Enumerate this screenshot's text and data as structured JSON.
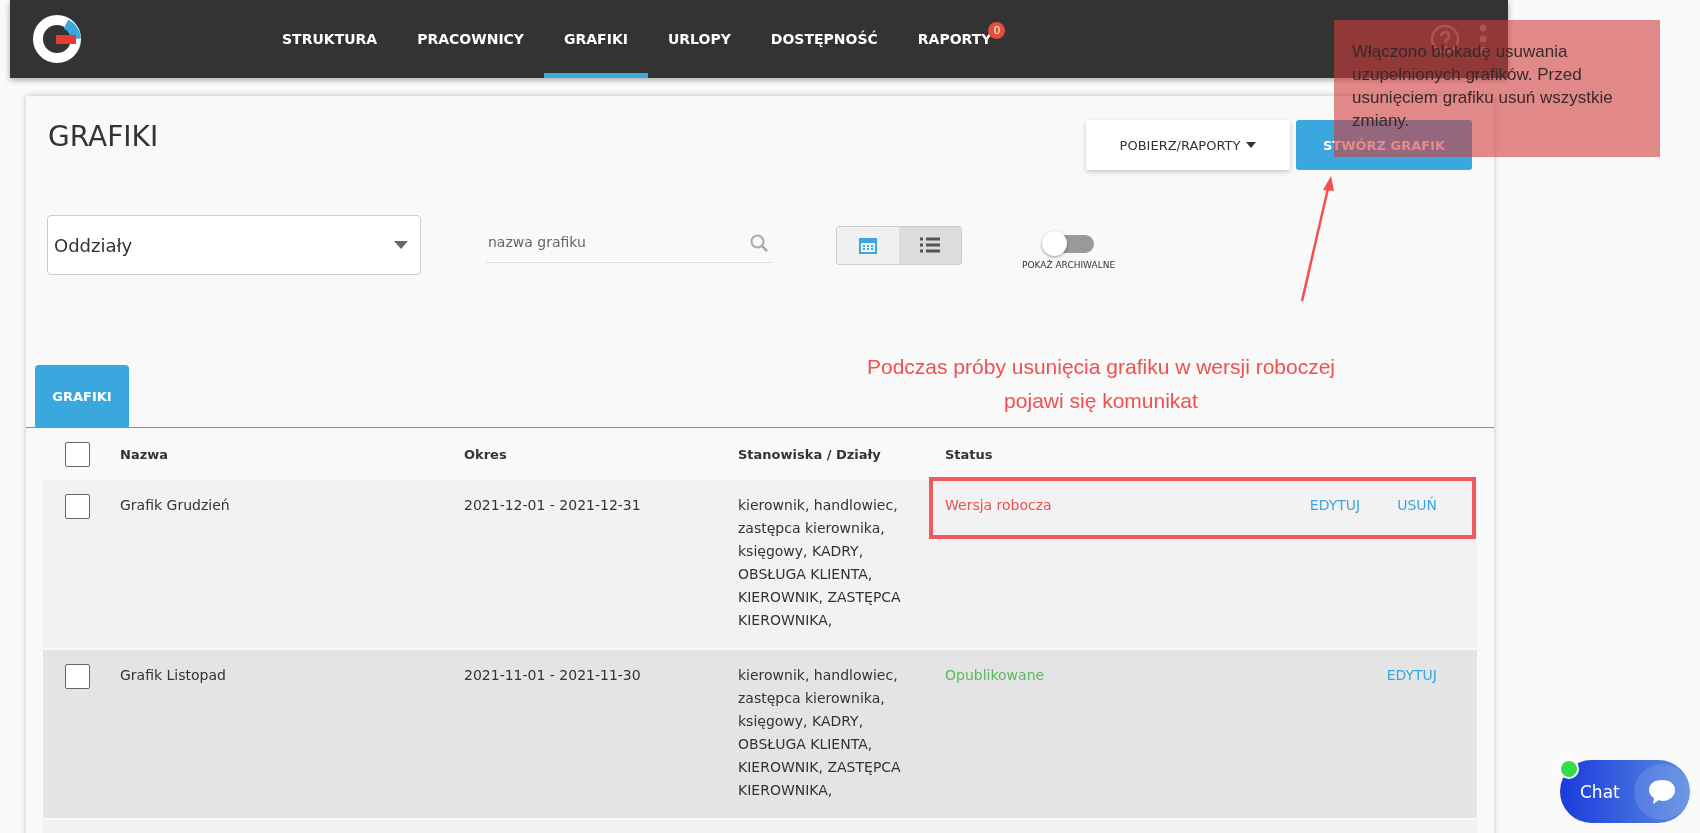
{
  "nav": {
    "items": [
      {
        "label": "STRUKTURA",
        "selected": false
      },
      {
        "label": "PRACOWNICY",
        "selected": false
      },
      {
        "label": "GRAFIKI",
        "selected": true
      },
      {
        "label": "URLOPY",
        "selected": false
      },
      {
        "label": "DOSTĘPNOŚĆ",
        "selected": false
      },
      {
        "label": "RAPORTY",
        "selected": false,
        "badge": "0"
      }
    ]
  },
  "toast": {
    "text": "Włączono blokadę usuwania uzupełnionych grafików. Przed usunięciem grafiku usuń wszystkie zmiany."
  },
  "page": {
    "title": "GRAFIKI",
    "buttons": [
      {
        "label": "POBIERZ/RAPORTY",
        "kind": "dropdown"
      },
      {
        "label": "STWÓRZ GRAFIK",
        "kind": "primary"
      }
    ]
  },
  "filters": {
    "select": {
      "value": "Oddziały"
    },
    "search": {
      "placeholder": "nazwa grafiku"
    },
    "views": [
      {
        "kind": "calendar",
        "selected": true
      },
      {
        "kind": "list",
        "selected": false
      }
    ],
    "archive": {
      "label": "POKAŻ ARCHIWALNE",
      "on": false
    }
  },
  "annotation": {
    "text": "Podczas próby usunięcia grafiku w wersji roboczej pojawi się komunikat"
  },
  "tabs": [
    {
      "label": "GRAFIKI",
      "selected": true
    }
  ],
  "table": {
    "columns": [
      "Nazwa",
      "Okres",
      "Stanowiska / Działy",
      "Status"
    ],
    "header_checked": false,
    "rows": [
      {
        "checked": false,
        "highlighted": true,
        "name": "Grafik Grudzień",
        "period": "2021-12-01 - 2021-12-31",
        "positions": "kierownik, handlowiec, zastępca kierownika, księgowy, KADRY, OBSŁUGA KLIENTA, KIEROWNIK, ZASTĘPCA KIEROWNIKA,",
        "status": "Wersja robocza",
        "color": "#f05050",
        "actions": [
          "EDYTUJ",
          "USUŃ"
        ]
      },
      {
        "checked": false,
        "highlighted": false,
        "name": "Grafik Listopad",
        "period": "2021-11-01 - 2021-11-30",
        "positions": "kierownik, handlowiec, zastępca kierownika, księgowy, KADRY, OBSŁUGA KLIENTA, KIEROWNIK, ZASTĘPCA KIEROWNIKA,",
        "status": "Opublikowane",
        "color": "#5cb85c",
        "actions": [
          "EDYTUJ"
        ]
      }
    ]
  },
  "chat": {
    "label": "Chat",
    "online": true
  }
}
